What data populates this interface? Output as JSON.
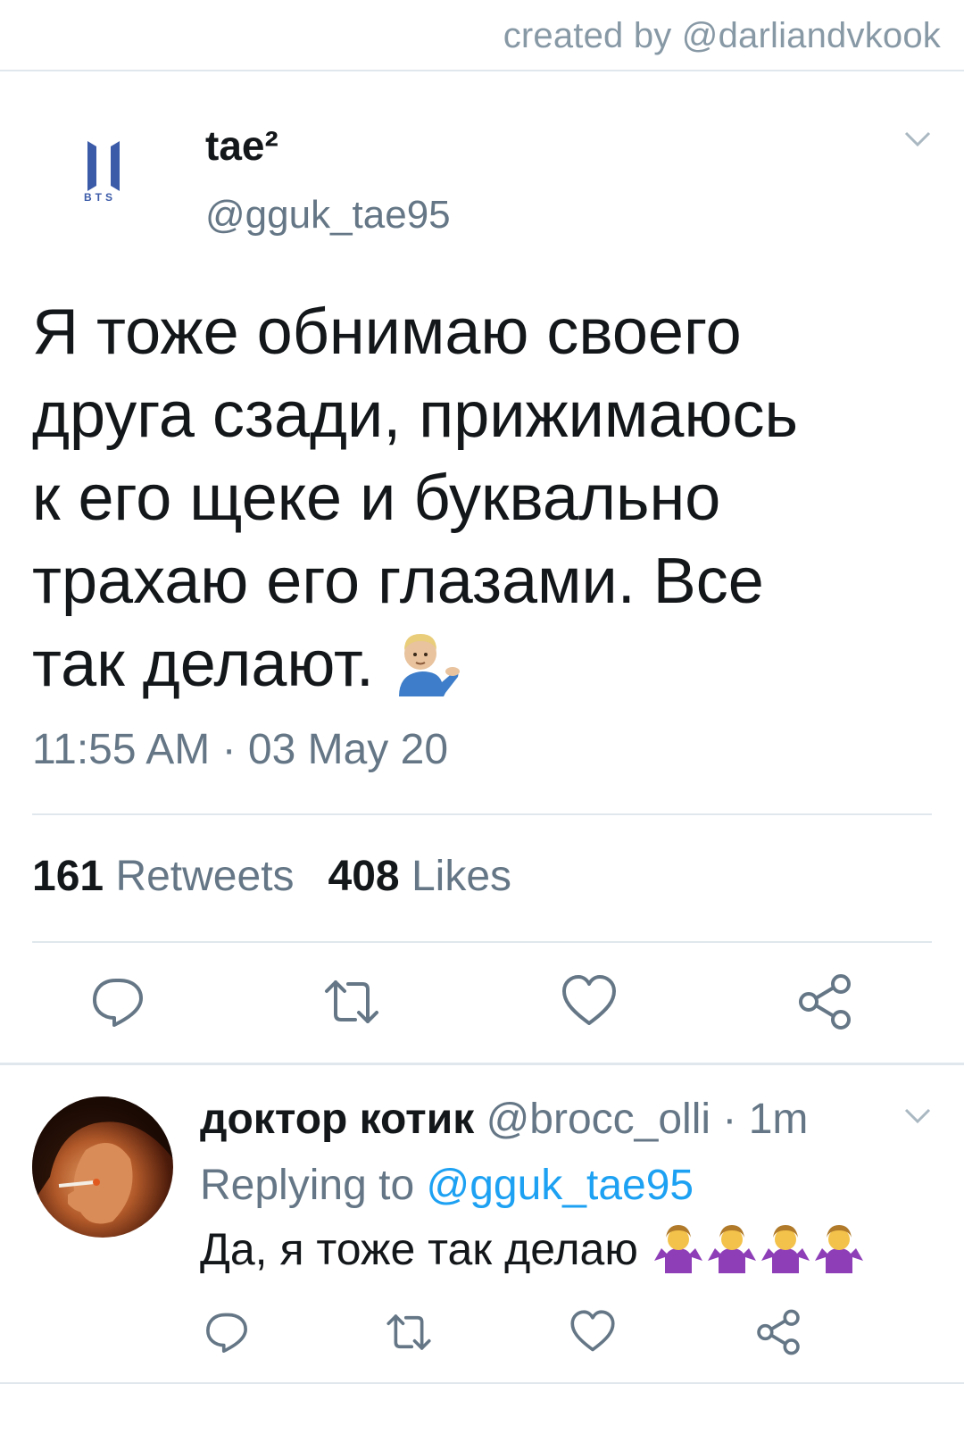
{
  "credit": "created by @darliandvkook",
  "tweet": {
    "avatar_label": "BTS",
    "display_name": "tae²",
    "handle": "@gguk_tae95",
    "text_lines": [
      "Я тоже обнимаю своего",
      "друга сзади, прижимаюсь",
      "к его щеке и буквально",
      "трахаю его глазами. Все",
      "так делают."
    ],
    "text_emoji": "man-tipping-hand-emoji",
    "timestamp": "11:55 AM · 03 May 20",
    "retweets_count": "161",
    "retweets_label": "Retweets",
    "likes_count": "408",
    "likes_label": "Likes"
  },
  "reply": {
    "name": "доктор котик",
    "handle": "@brocc_olli",
    "time": "· 1m",
    "replying_prefix": "Replying to",
    "replying_mention": "@gguk_tae95",
    "text": "Да, я тоже так делаю",
    "emoji": [
      "woman-shrugging-emoji",
      "woman-shrugging-emoji",
      "woman-shrugging-emoji",
      "woman-shrugging-emoji"
    ]
  },
  "colors": {
    "primary_text": "#14171a",
    "secondary_text": "#657786",
    "link": "#1da1f2",
    "divider": "#e1e8ed",
    "icon": "#657786"
  }
}
